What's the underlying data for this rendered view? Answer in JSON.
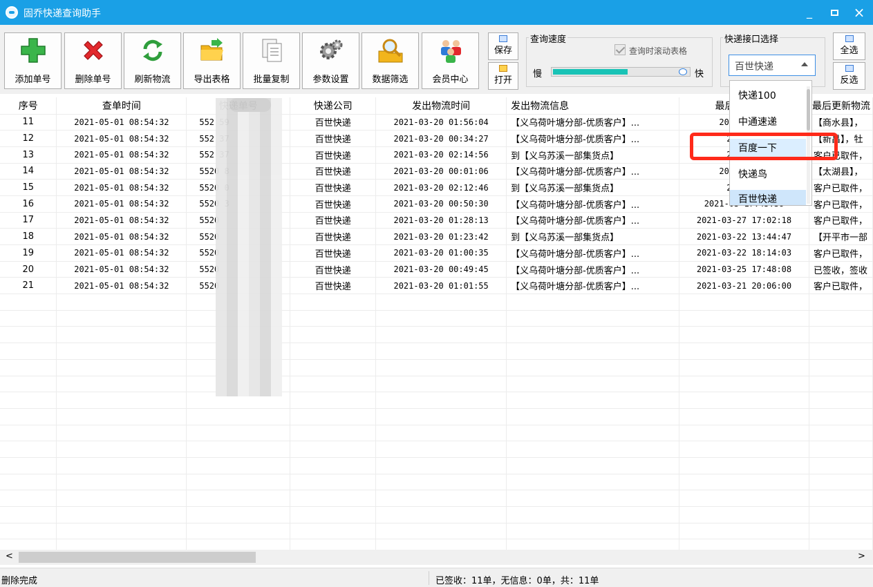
{
  "window": {
    "title": "固乔快递查询助手",
    "minimize": "_",
    "maximize": "□",
    "close": "×"
  },
  "toolbar": {
    "buttons": [
      {
        "label": "添加单号",
        "icon": "plus-icon"
      },
      {
        "label": "删除单号",
        "icon": "delete-x-icon"
      },
      {
        "label": "刷新物流",
        "icon": "refresh-icon"
      },
      {
        "label": "导出表格",
        "icon": "export-folder-icon"
      },
      {
        "label": "批量复制",
        "icon": "copy-docs-icon"
      },
      {
        "label": "参数设置",
        "icon": "gear-icon"
      },
      {
        "label": "数据筛选",
        "icon": "magnifier-folder-icon"
      },
      {
        "label": "会员中心",
        "icon": "users-icon"
      }
    ],
    "save_label": "保存",
    "open_label": "打开"
  },
  "speed": {
    "group_label": "查询速度",
    "scroll_checkbox_label": "查询时滚动表格",
    "scroll_checked": true,
    "slow_label": "慢",
    "fast_label": "快",
    "level": 0.55
  },
  "courier": {
    "group_label": "快递接口选择",
    "selected": "百世快递",
    "options": [
      "快递100",
      "中通速递",
      "百度一下",
      "快递鸟",
      "百世快递"
    ],
    "highlighted": "百度一下",
    "select_all_label": "全选",
    "invert_label": "反选"
  },
  "table": {
    "headers": [
      "序号",
      "查单时间",
      "快递单号",
      "快递公司",
      "发出物流时间",
      "发出物流信息",
      "最后更新时间",
      "最后更新物流"
    ],
    "rows": [
      {
        "idx": "11",
        "query_time": "2021-05-01 08:54:32",
        "number": "552 59",
        "company": "百世快递",
        "send_time": "2021-03-20 01:56:04",
        "send_info": "【义乌荷叶塘分部-优质客户】...",
        "update_time": "2021-03 15",
        "update_info": "【商水县】，"
      },
      {
        "idx": "12",
        "query_time": "2021-05-01 08:54:32",
        "number": "552 37",
        "company": "百世快递",
        "send_time": "2021-03-20 00:34:27",
        "send_info": "【义乌荷叶塘分部-优质客户】...",
        "update_time": "2021-03",
        "update_info": "【新昌】，牡"
      },
      {
        "idx": "13",
        "query_time": "2021-05-01 08:54:32",
        "number": "552 37",
        "company": "百世快递",
        "send_time": "2021-03-20 02:14:56",
        "send_info": "到【义乌苏溪一部集货点】",
        "update_time": "2021-03",
        "update_info": "客户已取件，"
      },
      {
        "idx": "14",
        "query_time": "2021-05-01 08:54:32",
        "number": "5520 8",
        "company": "百世快递",
        "send_time": "2021-03-20 00:01:06",
        "send_info": "【义乌荷叶塘分部-优质客户】...",
        "update_time": "2021-03 19",
        "update_info": "【太湖县】，"
      },
      {
        "idx": "15",
        "query_time": "2021-05-01 08:54:32",
        "number": "5520 0",
        "company": "百世快递",
        "send_time": "2021-03-20 02:12:46",
        "send_info": "到【义乌苏溪一部集货点】",
        "update_time": "2021-03",
        "update_info": "客户已取件，"
      },
      {
        "idx": "16",
        "query_time": "2021-05-01 08:54:32",
        "number": "5520 3",
        "company": "百世快递",
        "send_time": "2021-03-20 00:50:30",
        "send_info": "【义乌荷叶塘分部-优质客户】...",
        "update_time": "2021-03 17:45:38",
        "update_info": "客户已取件，"
      },
      {
        "idx": "17",
        "query_time": "2021-05-01 08:54:32",
        "number": "5520",
        "company": "百世快递",
        "send_time": "2021-03-20 01:28:13",
        "send_info": "【义乌荷叶塘分部-优质客户】...",
        "update_time": "2021-03-27 17:02:18",
        "update_info": "客户已取件，"
      },
      {
        "idx": "18",
        "query_time": "2021-05-01 08:54:32",
        "number": "5520",
        "company": "百世快递",
        "send_time": "2021-03-20 01:23:42",
        "send_info": "到【义乌苏溪一部集货点】",
        "update_time": "2021-03-22 13:44:47",
        "update_info": "【开平市一部"
      },
      {
        "idx": "19",
        "query_time": "2021-05-01 08:54:32",
        "number": "5520",
        "company": "百世快递",
        "send_time": "2021-03-20 01:00:35",
        "send_info": "【义乌荷叶塘分部-优质客户】...",
        "update_time": "2021-03-22 18:14:03",
        "update_info": "客户已取件，"
      },
      {
        "idx": "20",
        "query_time": "2021-05-01 08:54:32",
        "number": "5520",
        "company": "百世快递",
        "send_time": "2021-03-20 00:49:45",
        "send_info": "【义乌荷叶塘分部-优质客户】...",
        "update_time": "2021-03-25 17:48:08",
        "update_info": "已签收，签收"
      },
      {
        "idx": "21",
        "query_time": "2021-05-01 08:54:32",
        "number": "5520",
        "company": "百世快递",
        "send_time": "2021-03-20 01:01:55",
        "send_info": "【义乌荷叶塘分部-优质客户】...",
        "update_time": "2021-03-21 20:06:00",
        "update_info": "客户已取件，"
      }
    ],
    "empty_rows": 16
  },
  "scrollbar": {
    "left_arrow": "<",
    "right_arrow": ">"
  },
  "status": {
    "left": "删除完成",
    "summary": "已签收：11单，无信息：0单，共：11单"
  },
  "colors": {
    "titlebar": "#1aa0e6",
    "highlight": "#ff2a1a",
    "speed_fill": "#19c3b6",
    "combo_border": "#3c8ee4"
  }
}
